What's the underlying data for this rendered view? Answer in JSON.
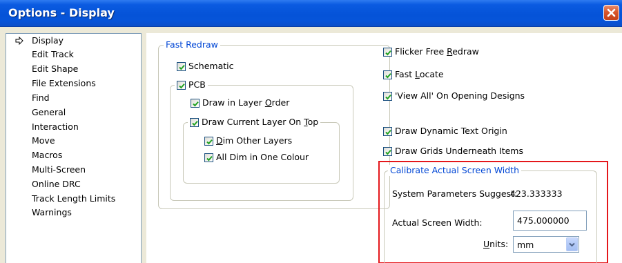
{
  "window": {
    "title": "Options - Display",
    "close_icon": "close-icon",
    "accent": "#0553d8"
  },
  "sidebar": {
    "items": [
      {
        "label": "Display",
        "selected": true
      },
      {
        "label": "Edit Track"
      },
      {
        "label": "Edit Shape"
      },
      {
        "label": "File Extensions"
      },
      {
        "label": "Find"
      },
      {
        "label": "General"
      },
      {
        "label": "Interaction"
      },
      {
        "label": "Move"
      },
      {
        "label": "Macros"
      },
      {
        "label": "Multi-Screen"
      },
      {
        "label": "Online DRC"
      },
      {
        "label": "Track Length Limits"
      },
      {
        "label": "Warnings"
      }
    ],
    "selected_icon": "right-arrow-icon"
  },
  "fast_redraw": {
    "title": "Fast Redraw",
    "schematic": {
      "label": "Schematic",
      "checked": true
    },
    "pcb": {
      "label": "PCB",
      "checked": true,
      "draw_in_layer_order": {
        "before": "Draw in Layer ",
        "ul": "O",
        "after": "rder",
        "checked": true
      },
      "draw_current_layer": {
        "before": "Draw Current Layer On ",
        "ul": "T",
        "after": "op",
        "checked": true,
        "dim_other_layers": {
          "before": "",
          "ul": "D",
          "after": "im Other Layers",
          "checked": true
        },
        "all_dim_one_colour": {
          "label": "All Dim in One Colour",
          "checked": true
        }
      }
    }
  },
  "options": {
    "flicker_free": {
      "before": "Flicker Free ",
      "ul": "R",
      "after": "edraw",
      "checked": true
    },
    "fast_locate": {
      "before": "Fast ",
      "ul": "L",
      "after": "ocate",
      "checked": true
    },
    "view_all": {
      "label": "'View All' On Opening Designs",
      "checked": true
    },
    "dynamic_text": {
      "label": "Draw Dynamic Text Origin",
      "checked": true
    },
    "grids_underneath": {
      "label": "Draw Grids Underneath Items",
      "checked": true
    }
  },
  "calibrate": {
    "title": "Calibrate Actual Screen Width",
    "suggest_label": "System Parameters Suggest:",
    "suggest_value": "423.333333",
    "width_label": "Actual Screen Width:",
    "width_value": "475.000000",
    "units_label_ul": "U",
    "units_label_rest": "nits:",
    "units_value": "mm",
    "highlight_color": "#e4171b"
  }
}
